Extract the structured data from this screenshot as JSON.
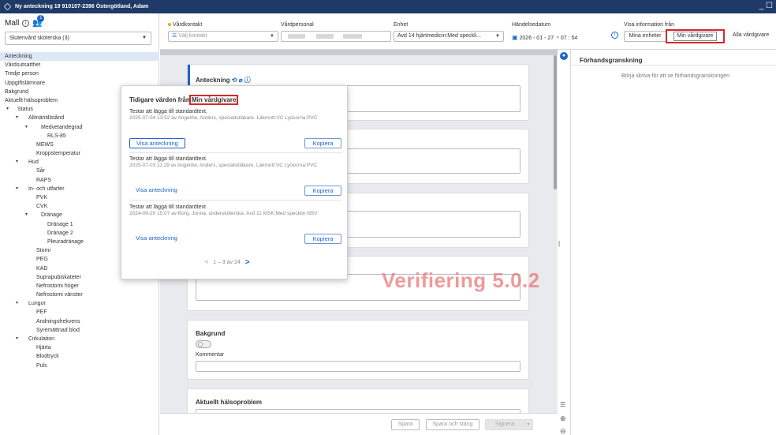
{
  "window": {
    "title": "Ny anteckning 19 910107-2396 Östergötland, Adam",
    "minimize": "_ ☐"
  },
  "left": {
    "mall_label": "Mall",
    "badge": "1",
    "mall_select": "Slutenvård sköterska (3)",
    "tree": [
      {
        "label": "Anteckning",
        "level": 0,
        "selected": true
      },
      {
        "label": "Vårdsutsatthet",
        "level": 0
      },
      {
        "label": "Tredje person",
        "level": 0
      },
      {
        "label": "Uppgiftslämnare",
        "level": 0
      },
      {
        "label": "Bakgrund",
        "level": 0
      },
      {
        "label": "Aktuellt hälsoproblem",
        "level": 0
      },
      {
        "label": "Status",
        "level": 0,
        "toggle": "▾"
      },
      {
        "label": "Allmäntillstånd",
        "level": 1,
        "toggle": "▾"
      },
      {
        "label": "Medvetandegrad",
        "level": 2,
        "toggle": "▾"
      },
      {
        "label": "RLS-85",
        "level": 3
      },
      {
        "label": "MEWS",
        "level": 2
      },
      {
        "label": "Kroppstemperatur",
        "level": 2
      },
      {
        "label": "Hud",
        "level": 1,
        "toggle": "▾"
      },
      {
        "label": "Sår",
        "level": 2
      },
      {
        "label": "RAPS",
        "level": 2
      },
      {
        "label": "In- och utfarter",
        "level": 1,
        "toggle": "▾"
      },
      {
        "label": "PVK",
        "level": 2
      },
      {
        "label": "CVK",
        "level": 2
      },
      {
        "label": "Dränage",
        "level": 2,
        "toggle": "▾"
      },
      {
        "label": "Dränage 1",
        "level": 3
      },
      {
        "label": "Dränage 2",
        "level": 3
      },
      {
        "label": "Pleuradränage",
        "level": 3
      },
      {
        "label": "Stomi",
        "level": 2
      },
      {
        "label": "PEG",
        "level": 2
      },
      {
        "label": "KAD",
        "level": 2
      },
      {
        "label": "Suprapubiskateter",
        "level": 2
      },
      {
        "label": "Nefrostomi höger",
        "level": 2
      },
      {
        "label": "Nefrostomi vänster",
        "level": 2
      },
      {
        "label": "Lungor",
        "level": 1,
        "toggle": "▾"
      },
      {
        "label": "PEF",
        "level": 2
      },
      {
        "label": "Andningsfrekvens",
        "level": 2
      },
      {
        "label": "Syremättnad blod",
        "level": 2
      },
      {
        "label": "Cirkulation",
        "level": 1,
        "toggle": "▾"
      },
      {
        "label": "Hjärta",
        "level": 2
      },
      {
        "label": "Blodtryck",
        "level": 2
      },
      {
        "label": "Puls",
        "level": 2
      }
    ]
  },
  "header": {
    "vardkontakt_label": "Vårdkontakt",
    "vardkontakt_placeholder": "Välj kontakt",
    "vardpersonal_label": "Vårdpersonal",
    "enhet_label": "Enhet",
    "enhet_value": "Avd 14 hjärtmedicin:Med speckli...",
    "handelsedatum_label": "Händelsedatum",
    "date_value": "2026 - 01 - 27",
    "time_value": "07 : 54",
    "visa_info_label": "Visa information från",
    "btn_mina": "Mina enheter",
    "btn_min_vardgivare": "Min vårdgivare",
    "btn_alla": "Alla vårdgivare"
  },
  "cards": {
    "anteckning_title": "Anteckning",
    "bakgrund_title": "Bakgrund",
    "kommentar_label": "Kommentar",
    "aktuellt_title": "Aktuellt hälsoproblem"
  },
  "popup": {
    "title": "Tidigare värden från",
    "title_highlight": "Min vårdgivare",
    "entries": [
      {
        "title": "Testar att lägga till standardtext.",
        "meta": "2025-07-04 13:52 av Angelöw, Anders, specialistläkare. Läkmott:VC Lyckorna:PVC",
        "visa": "Visa anteckning",
        "kopiera": "Kopiera"
      },
      {
        "title": "Testar att lägga till standardtext.",
        "meta": "2025-07-03 11:29 av Angelöw, Anders, specialistläkare. Läkmott:VC Lyckorna:PVC",
        "visa": "Visa anteckning",
        "kopiera": "Kopiera"
      },
      {
        "title": "Testar att lägga till standardtext.",
        "meta": "2024-09-20 15:07 av Borg, Jonna, undersköterska. Avd 11 MSK:Med specklin:NSV",
        "visa": "Visa anteckning",
        "kopiera": "Kopiera"
      }
    ],
    "pager_text": "1 – 3 av 24"
  },
  "watermark": "Verifiering 5.0.2",
  "preview": {
    "title": "Förhandsgranskning",
    "hint": "Börja skriva för att se förhandsgranskningen"
  },
  "footer": {
    "spara": "Spara",
    "spara_stang": "Spara och stäng",
    "signera": "Signera"
  },
  "colors": {
    "accent": "#1f63c6",
    "titlebar": "#1f3a66",
    "highlight": "#d8282a"
  }
}
